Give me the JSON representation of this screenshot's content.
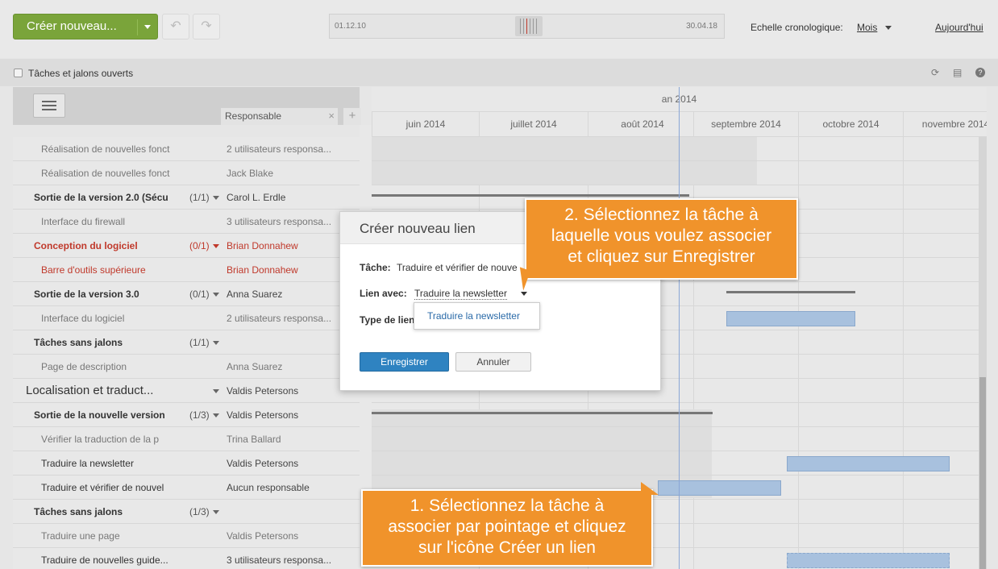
{
  "toolbar": {
    "create_label": "Créer nouveau...",
    "undo_icon": "undo-icon",
    "redo_icon": "redo-icon",
    "timeline_start": "01.12.10",
    "timeline_end": "30.04.18",
    "scale_label": "Echelle cronologique:",
    "scale_value": "Mois",
    "today_label": "Aujourd'hui"
  },
  "subbar": {
    "checkbox_label": "Tâches et jalons ouverts"
  },
  "grid": {
    "responsible_header": "Responsable",
    "rows": [
      {
        "name": "Réalisation de nouvelles fonct",
        "count": "",
        "responsible": "2 utilisateurs responsa...",
        "style": "sub"
      },
      {
        "name": "Réalisation de nouvelles fonct",
        "count": "",
        "responsible": "Jack Blake",
        "style": "sub"
      },
      {
        "name": "Sortie de la version 2.0 (Sécu",
        "count": "(1/1)",
        "responsible": "Carol L. Erdle",
        "style": "bold"
      },
      {
        "name": "Interface du firewall",
        "count": "",
        "responsible": "3 utilisateurs responsa...",
        "style": "sub"
      },
      {
        "name": "Conception du logiciel",
        "count": "(0/1)",
        "responsible": "Brian Donnahew",
        "style": "bold-red"
      },
      {
        "name": "Barre d'outils supérieure",
        "count": "",
        "responsible": "Brian Donnahew",
        "style": "sub-red"
      },
      {
        "name": "Sortie de la version 3.0",
        "count": "(0/1)",
        "responsible": "Anna Suarez",
        "style": "bold"
      },
      {
        "name": "Interface du logiciel",
        "count": "",
        "responsible": "2 utilisateurs responsa...",
        "style": "sub"
      },
      {
        "name": "Tâches sans jalons",
        "count": "(1/1)",
        "responsible": "",
        "style": "bold"
      },
      {
        "name": "Page de description",
        "count": "",
        "responsible": "Anna Suarez",
        "style": "sub"
      },
      {
        "name": "Localisation et traduct...",
        "count": "",
        "responsible": "Valdis Petersons",
        "style": "big"
      },
      {
        "name": "Sortie de la nouvelle version",
        "count": "(1/3)",
        "responsible": "Valdis Petersons",
        "style": "bold"
      },
      {
        "name": "Vérifier la traduction de la p",
        "count": "",
        "responsible": "Trina Ballard",
        "style": "sub"
      },
      {
        "name": "Traduire la newsletter",
        "count": "",
        "responsible": "Valdis Petersons",
        "style": "sub-dark"
      },
      {
        "name": "Traduire et vérifier de nouvel",
        "count": "",
        "responsible": "Aucun responsable",
        "style": "sub-dark"
      },
      {
        "name": "Tâches sans jalons",
        "count": "(1/3)",
        "responsible": "",
        "style": "bold"
      },
      {
        "name": "Traduire une page",
        "count": "",
        "responsible": "Valdis Petersons",
        "style": "sub"
      },
      {
        "name": "Traduire de nouvelles guide...",
        "count": "",
        "responsible": "3 utilisateurs responsa...",
        "style": "sub-dark"
      }
    ]
  },
  "gantt": {
    "year_label": "an 2014",
    "months": [
      "juin 2014",
      "juillet 2014",
      "août 2014",
      "septembre 2014",
      "octobre 2014",
      "novembre 2014"
    ]
  },
  "dialog": {
    "title": "Créer nouveau lien",
    "task_label": "Tâche:",
    "task_value": "Traduire et vérifier de nouve",
    "link_label": "Lien avec:",
    "link_value": "Traduire la newsletter",
    "type_label": "Type de lien",
    "dropdown_option": "Traduire la newsletter",
    "save_label": "Enregistrer",
    "cancel_label": "Annuler"
  },
  "callouts": {
    "step2": [
      "2. Sélectionnez la tâche à",
      "laquelle vous voulez associer",
      "et cliquez sur Enregistrer"
    ],
    "step1": [
      "1. Sélectionnez la tâche à",
      "associer par pointage et cliquez",
      "sur l'icône Créer un lien"
    ]
  },
  "colors": {
    "accent_green": "#7aa43a",
    "callout_orange": "#f0932b",
    "primary_blue": "#2f83c1",
    "overdue_red": "#c0392b",
    "bar_blue": "#a8c1de"
  }
}
